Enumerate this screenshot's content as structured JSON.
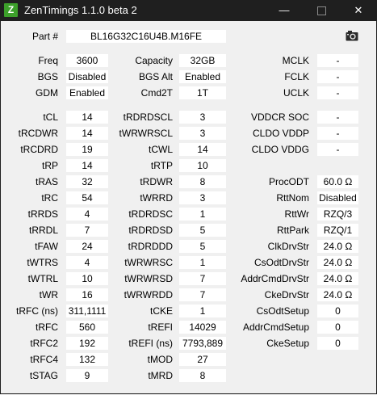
{
  "window": {
    "app_letter": "Z",
    "title": "ZenTimings 1.1.0 beta 2",
    "minimize": "—",
    "close": "✕"
  },
  "part": {
    "label": "Part #",
    "value": "BL16G32C16U4B.M16FE"
  },
  "col1": [
    [
      "Freq",
      "3600"
    ],
    [
      "BGS",
      "Disabled"
    ],
    [
      "GDM",
      "Enabled"
    ],
    [
      "tCL",
      "14"
    ],
    [
      "tRCDWR",
      "14"
    ],
    [
      "tRCDRD",
      "19"
    ],
    [
      "tRP",
      "14"
    ],
    [
      "tRAS",
      "32"
    ],
    [
      "tRC",
      "54"
    ],
    [
      "tRRDS",
      "4"
    ],
    [
      "tRRDL",
      "7"
    ],
    [
      "tFAW",
      "24"
    ],
    [
      "tWTRS",
      "4"
    ],
    [
      "tWTRL",
      "10"
    ],
    [
      "tWR",
      "16"
    ],
    [
      "tRFC (ns)",
      "311,1111"
    ],
    [
      "tRFC",
      "560"
    ],
    [
      "tRFC2",
      "192"
    ],
    [
      "tRFC4",
      "132"
    ],
    [
      "tSTAG",
      "9"
    ]
  ],
  "col2": [
    [
      "Capacity",
      "32GB"
    ],
    [
      "BGS Alt",
      "Enabled"
    ],
    [
      "Cmd2T",
      "1T"
    ],
    [
      "tRDRDSCL",
      "3"
    ],
    [
      "tWRWRSCL",
      "3"
    ],
    [
      "tCWL",
      "14"
    ],
    [
      "tRTP",
      "10"
    ],
    [
      "tRDWR",
      "8"
    ],
    [
      "tWRRD",
      "3"
    ],
    [
      "tRDRDSC",
      "1"
    ],
    [
      "tRDRDSD",
      "5"
    ],
    [
      "tRDRDDD",
      "5"
    ],
    [
      "tWRWRSC",
      "1"
    ],
    [
      "tWRWRSD",
      "7"
    ],
    [
      "tWRWRDD",
      "7"
    ],
    [
      "tCKE",
      "1"
    ],
    [
      "tREFI",
      "14029"
    ],
    [
      "tREFI (ns)",
      "7793,889"
    ],
    [
      "tMOD",
      "27"
    ],
    [
      "tMRD",
      "8"
    ]
  ],
  "col3": [
    [
      "MCLK",
      "-"
    ],
    [
      "FCLK",
      "-"
    ],
    [
      "UCLK",
      "-"
    ],
    [
      "VDDCR SOC",
      "-"
    ],
    [
      "CLDO VDDP",
      "-"
    ],
    [
      "CLDO VDDG",
      "-"
    ],
    [
      "",
      ""
    ],
    [
      "ProcODT",
      "60.0 Ω"
    ],
    [
      "RttNom",
      "Disabled"
    ],
    [
      "RttWr",
      "RZQ/3"
    ],
    [
      "RttPark",
      "RZQ/1"
    ],
    [
      "ClkDrvStr",
      "24.0 Ω"
    ],
    [
      "CsOdtDrvStr",
      "24.0 Ω"
    ],
    [
      "AddrCmdDrvStr",
      "24.0 Ω"
    ],
    [
      "CkeDrvStr",
      "24.0 Ω"
    ],
    [
      "CsOdtSetup",
      "0"
    ],
    [
      "AddrCmdSetup",
      "0"
    ],
    [
      "CkeSetup",
      "0"
    ],
    [
      "",
      ""
    ],
    [
      "",
      ""
    ]
  ],
  "icons": {
    "camera": "camera-icon",
    "app": "zentimings-logo-icon"
  },
  "colors": {
    "titlebar": "#1f1f1f",
    "app_icon": "#3c9f2a",
    "background": "#f0f0f0"
  }
}
